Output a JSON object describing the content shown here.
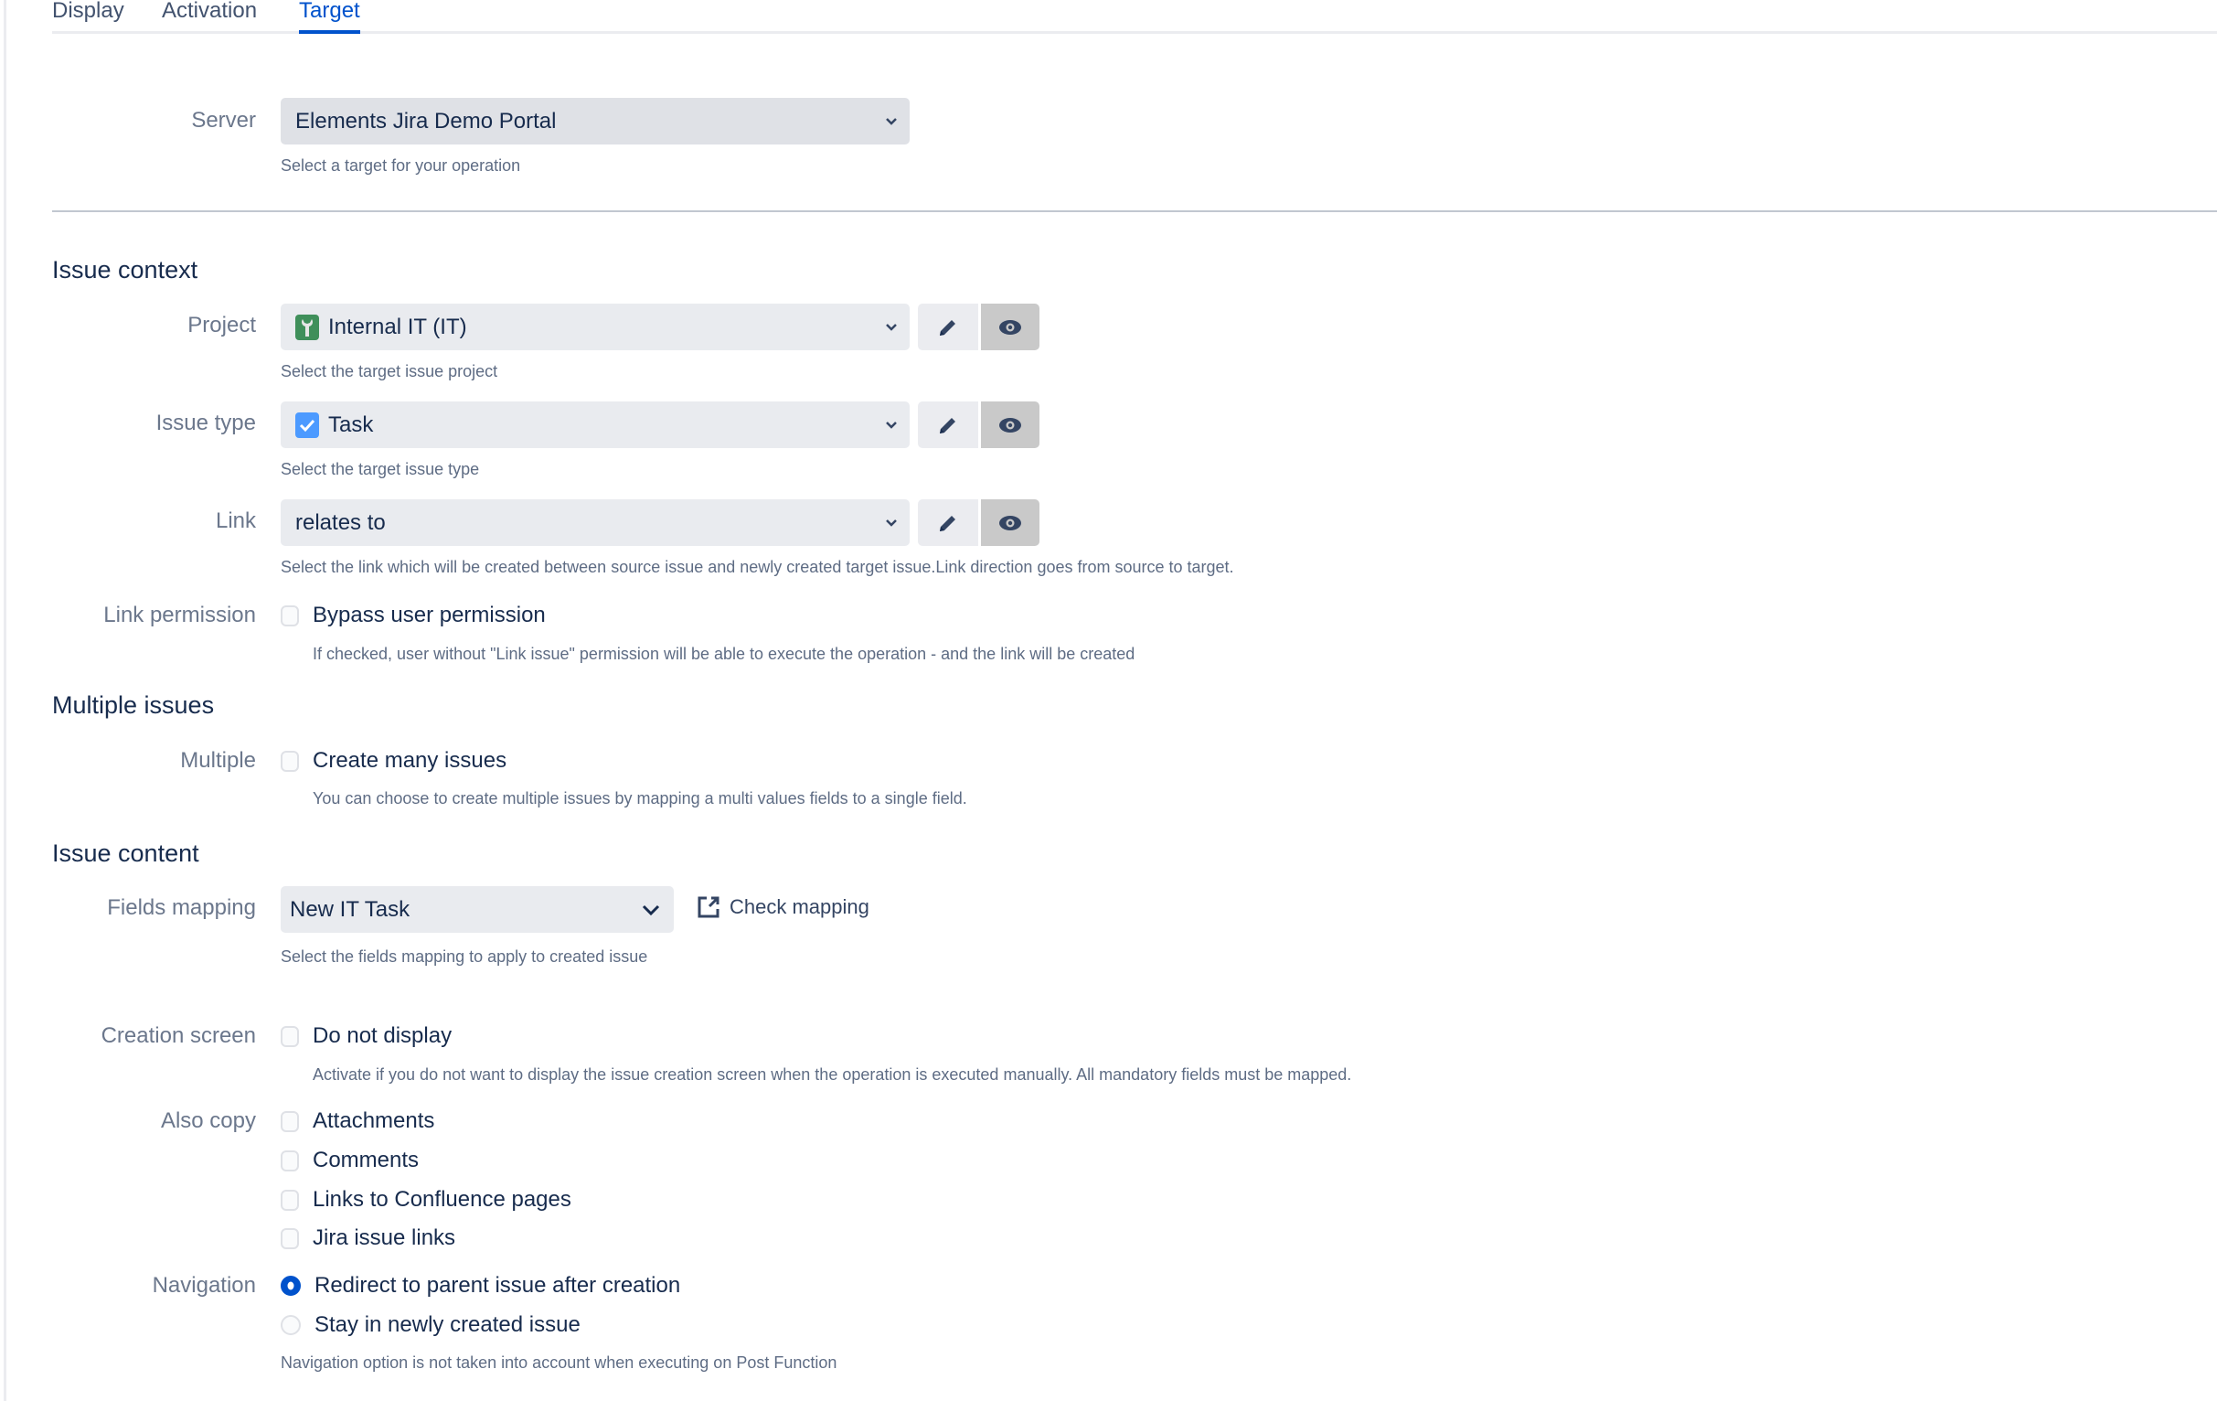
{
  "tabs": [
    {
      "label": "Display",
      "active": false
    },
    {
      "label": "Activation",
      "active": false
    },
    {
      "label": "Target",
      "active": true
    }
  ],
  "server": {
    "label": "Server",
    "value": "Elements Jira Demo Portal",
    "help": "Select a target for your operation"
  },
  "issue_context": {
    "heading": "Issue context",
    "project": {
      "label": "Project",
      "value": "Internal IT (IT)",
      "icon": "wrench-project-icon",
      "help": "Select the target issue project"
    },
    "issue_type": {
      "label": "Issue type",
      "value": "Task",
      "icon": "task-checkbox-icon",
      "help": "Select the target issue type"
    },
    "link": {
      "label": "Link",
      "value": "relates to",
      "help": "Select the link which will be created between source issue and newly created target issue.Link direction goes from source to target."
    },
    "link_permission": {
      "label": "Link permission",
      "option": "Bypass user permission",
      "checked": false,
      "help": "If checked, user without \"Link issue\" permission will be able to execute the operation - and the link will be created"
    }
  },
  "multiple_issues": {
    "heading": "Multiple issues",
    "label": "Multiple",
    "option": "Create many issues",
    "checked": false,
    "help": "You can choose to create multiple issues by mapping a multi values fields to a single field."
  },
  "issue_content": {
    "heading": "Issue content",
    "fields_mapping": {
      "label": "Fields mapping",
      "value": "New IT Task",
      "check_link": "Check mapping",
      "help": "Select the fields mapping to apply to created issue"
    },
    "creation_screen": {
      "label": "Creation screen",
      "option": "Do not display",
      "checked": false,
      "help": "Activate if you do not want to display the issue creation screen when the operation is executed manually. All mandatory fields must be mapped."
    },
    "also_copy": {
      "label": "Also copy",
      "options": [
        {
          "label": "Attachments",
          "checked": false
        },
        {
          "label": "Comments",
          "checked": false
        },
        {
          "label": "Links to Confluence pages",
          "checked": false
        },
        {
          "label": "Jira issue links",
          "checked": false
        }
      ]
    },
    "navigation": {
      "label": "Navigation",
      "options": [
        {
          "label": "Redirect to parent issue after creation",
          "selected": true
        },
        {
          "label": "Stay in newly created issue",
          "selected": false
        }
      ],
      "help": "Navigation option is not taken into account when executing on Post Function"
    }
  },
  "colors": {
    "accent": "#0052cc",
    "project_icon": "#3f8f5a",
    "task_icon": "#4c9aff"
  }
}
